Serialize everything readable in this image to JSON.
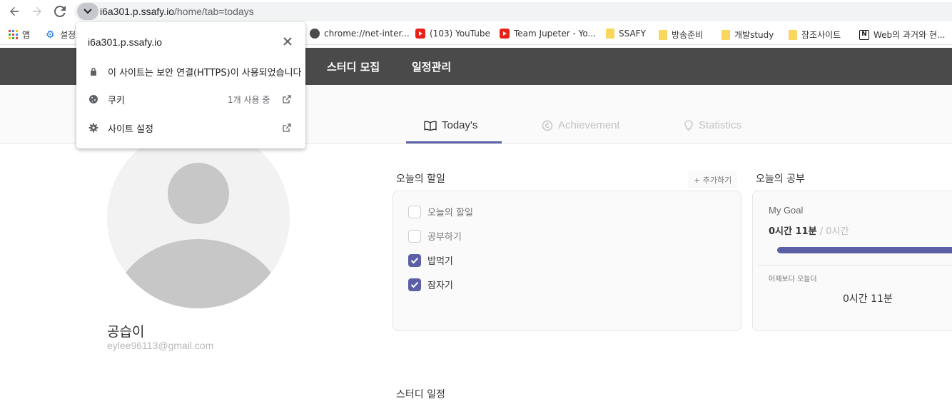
{
  "browser": {
    "url_host": "i6a301.p.ssafy.io",
    "url_path": "/home/tab=todays",
    "bookmarks": [
      {
        "label": "앱",
        "icon": "apps-grid-icon"
      },
      {
        "label": "설정",
        "icon": "settings-gear-icon"
      },
      {
        "label": "chrome://net-inter...",
        "icon": "globe-icon"
      },
      {
        "label": "(103) YouTube",
        "icon": "youtube-icon"
      },
      {
        "label": "Team Jupeter - Yo...",
        "icon": "youtube-icon"
      },
      {
        "label": "SSAFY",
        "icon": "folder-icon"
      },
      {
        "label": "방송준비",
        "icon": "folder-icon"
      },
      {
        "label": "개발study",
        "icon": "folder-icon"
      },
      {
        "label": "참조사이트",
        "icon": "folder-icon"
      },
      {
        "label": "Web의 과거와 현...",
        "icon": "notion-icon"
      }
    ]
  },
  "site_info_popup": {
    "domain": "i6a301.p.ssafy.io",
    "security_text": "이 사이트는 보안 연결(HTTPS)이 사용되었습니다",
    "cookies_label": "쿠키",
    "cookies_value": "1개 사용 중",
    "site_settings_label": "사이트 설정"
  },
  "header": {
    "menu": [
      "스터디 모집",
      "일정관리"
    ]
  },
  "tabs": [
    {
      "label": "Today's",
      "icon": "book-icon",
      "active": true
    },
    {
      "label": "Achievement",
      "icon": "copyright-icon",
      "active": false
    },
    {
      "label": "Statistics",
      "icon": "lightbulb-icon",
      "active": false
    }
  ],
  "profile": {
    "name": "공습이",
    "email": "eylee96113@gmail.com"
  },
  "todos": {
    "title": "오늘의 할일",
    "add_label": "+ 추가하기",
    "items": [
      {
        "label": "오늘의 할일",
        "checked": false
      },
      {
        "label": "공부하기",
        "checked": false
      },
      {
        "label": "밥먹기",
        "checked": true
      },
      {
        "label": "잠자기",
        "checked": true
      }
    ]
  },
  "study": {
    "title": "오늘의 공부",
    "goal_title": "My Goal",
    "time_done": "0시간 11분",
    "separator": "/",
    "time_goal": "0시간",
    "progress_fraction": 1.0,
    "compare_label": "어제보다 오늘더",
    "compare_value": "0시간 11분"
  },
  "schedule": {
    "title": "스터디 일정"
  },
  "colors": {
    "accent": "#5b5fa5",
    "header_bg": "#4a4a4a"
  }
}
